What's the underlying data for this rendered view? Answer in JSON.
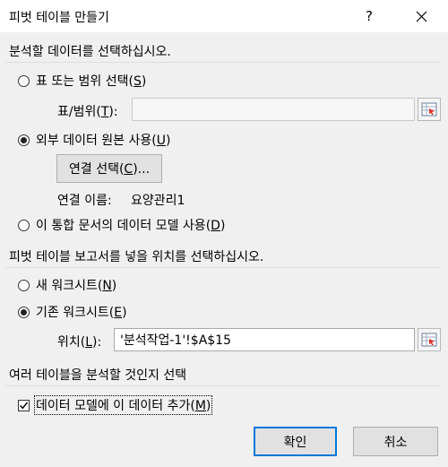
{
  "window": {
    "title": "피벗 테이블 만들기",
    "help_label": "?"
  },
  "data_section": {
    "heading": "분석할 데이터를 선택하십시오.",
    "option_table": {
      "label": "표 또는 범위 선택(",
      "key": "S",
      "end": ")",
      "selected": false
    },
    "table_field": {
      "label": "표/범위(",
      "key": "T",
      "end": "):",
      "value": "",
      "disabled": true
    },
    "option_external": {
      "label": "외부 데이터 원본 사용(",
      "key": "U",
      "end": ")",
      "selected": true
    },
    "connection_button": {
      "label": "연결 선택(",
      "key": "C",
      "end": ")..."
    },
    "connection_name": {
      "label": "연결 이름:",
      "value": "요양관리1"
    },
    "option_model": {
      "label": "이 통합 문서의 데이터 모델 사용(",
      "key": "D",
      "end": ")",
      "selected": false
    }
  },
  "location_section": {
    "heading": "피벗 테이블 보고서를 넣을 위치를 선택하십시오.",
    "option_new": {
      "label": "새 워크시트(",
      "key": "N",
      "end": ")",
      "selected": false
    },
    "option_existing": {
      "label": "기존 워크시트(",
      "key": "E",
      "end": ")",
      "selected": true
    },
    "location_field": {
      "label": "위치(",
      "key": "L",
      "end": "):",
      "value": "'분석작업-1'!$A$15"
    }
  },
  "multi_section": {
    "heading": "여러 테이블을 분석할 것인지 선택",
    "add_to_model": {
      "label": "데이터 모델에 이 데이터 추가(",
      "key": "M",
      "end": ")",
      "checked": true
    }
  },
  "buttons": {
    "ok": "확인",
    "cancel": "취소"
  },
  "icons": {
    "help": "help-icon",
    "close": "close-icon",
    "range_picker": "range-picker-icon"
  },
  "colors": {
    "accent": "#0078d7",
    "picker_red": "#d9342b"
  }
}
